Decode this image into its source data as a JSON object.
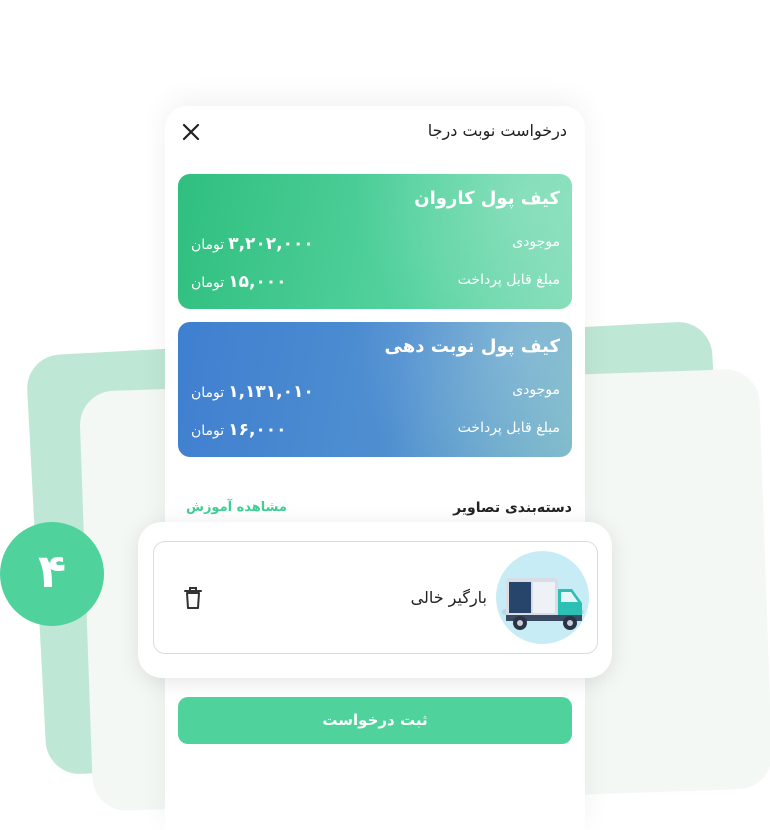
{
  "header": {
    "title": "درخواست نوبت درجا"
  },
  "wallets": [
    {
      "title": "کیف پول کاروان",
      "balance_label": "موجودی",
      "balance_value": "۳,۲۰۲,۰۰۰",
      "payable_label": "مبلغ قابل پرداخت",
      "payable_value": "۱۵,۰۰۰",
      "currency": "تومان",
      "color": "#2fbf7f"
    },
    {
      "title": "کیف پول نوبت دهی",
      "balance_label": "موجودی",
      "balance_value": "۱,۱۳۱,۰۱۰",
      "payable_label": "مبلغ قابل پرداخت",
      "payable_value": "۱۶,۰۰۰",
      "currency": "تومان",
      "color": "#3f7fd0"
    }
  ],
  "images_section": {
    "title": "دسته‌بندی تصاویر",
    "link": "مشاهده آموزش"
  },
  "item": {
    "label": "بارگیر خالی",
    "icon": "truck-icon"
  },
  "step_badge": "۴",
  "submit_label": "ثبت درخواست",
  "colors": {
    "accent": "#4fd29b",
    "blue": "#3f7fd0"
  }
}
